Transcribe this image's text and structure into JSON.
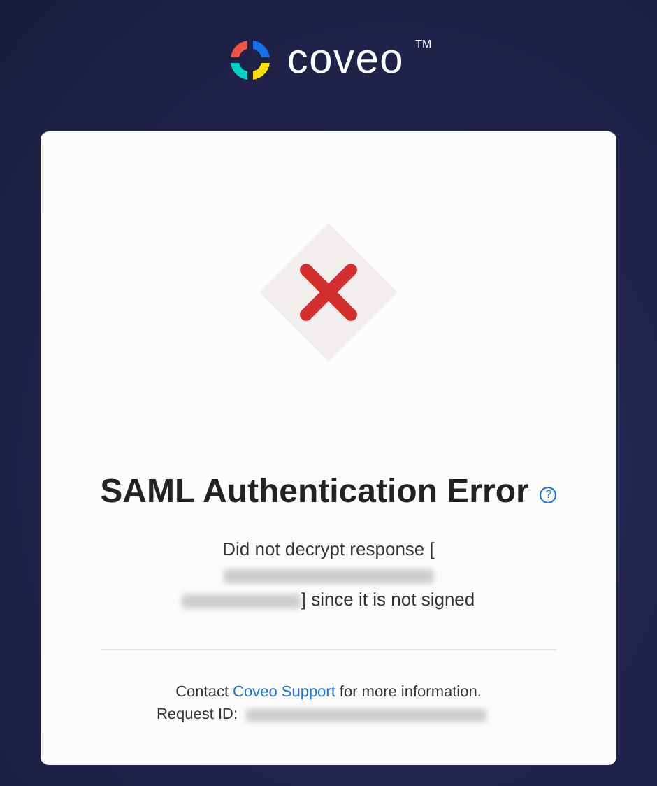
{
  "logo": {
    "wordmark": "coveo",
    "trademark": "TM"
  },
  "error": {
    "title": "SAML Authentication Error",
    "help_icon": "?",
    "message_before": "Did not decrypt response [",
    "message_after": "] since it is not signed"
  },
  "footer": {
    "contact_before": "Contact",
    "contact_link": "Coveo Support",
    "contact_after": "for more information.",
    "request_id_label": "Request ID:"
  }
}
